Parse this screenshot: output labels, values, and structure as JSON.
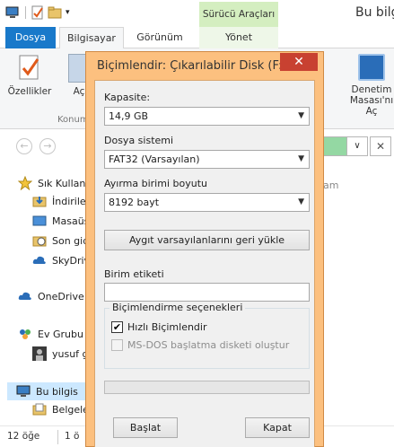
{
  "explorer": {
    "window_title": "Bu bilgis",
    "contextual_tab": "Sürücü Araçları",
    "tabs": [
      "Dosya",
      "Bilgisayar",
      "Görünüm",
      "Yönet"
    ],
    "ribbon": {
      "properties_label": "Özellikler",
      "open_label": "Aç",
      "group_label": "Konum",
      "control_panel_line1": "Denetim",
      "control_panel_line2": "Masası'nı Aç"
    },
    "ram_fragment": "am",
    "sidebar": {
      "favorites": "Sık Kullan",
      "downloads": "İndirile",
      "desktop": "Masaüs",
      "recent": "Son gid",
      "skydrive": "SkyDriv",
      "onedrive": "OneDrive",
      "homegroup": "Ev Grubu",
      "user": "yusuf g",
      "computer": "Bu bilgis",
      "documents": "Belgele"
    },
    "status": {
      "items": "12 öğe",
      "selected": "1 ö"
    }
  },
  "dialog": {
    "title": "Biçimlendir: Çıkarılabilir Disk (F:)",
    "close_glyph": "✕",
    "capacity_label": "Kapasite:",
    "capacity_value": "14,9 GB",
    "filesystem_label": "Dosya sistemi",
    "filesystem_value": "FAT32 (Varsayılan)",
    "allocation_label": "Ayırma birimi boyutu",
    "allocation_value": "8192 bayt",
    "restore_defaults": "Aygıt varsayılanlarını geri yükle",
    "volume_label": "Birim etiketi",
    "volume_value": "",
    "options_group": "Biçimlendirme seçenekleri",
    "quick_format": "Hızlı Biçimlendir",
    "quick_format_checked": true,
    "msdos_disk": "MS-DOS başlatma disketi oluştur",
    "msdos_checked": false,
    "progress": 0,
    "start_button": "Başlat",
    "close_button": "Kapat"
  }
}
